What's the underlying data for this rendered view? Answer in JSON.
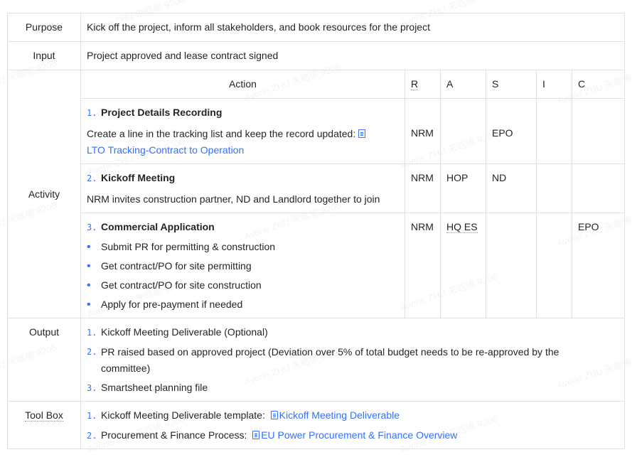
{
  "watermark": "Averie ZHU 朱皓瑜 9206",
  "rows": {
    "purpose": {
      "label": "Purpose",
      "text": "Kick off the project, inform all stakeholders, and book resources for the project"
    },
    "input": {
      "label": "Input",
      "text": "Project approved and lease contract signed"
    },
    "activity": {
      "label": "Activity",
      "headers": {
        "action": "Action",
        "r": "R",
        "a": "A",
        "s": "S",
        "i": "I",
        "c": "C"
      },
      "items": [
        {
          "num": "1.",
          "title": "Project Details Recording",
          "desc": "Create a line in the tracking list and keep the record updated:",
          "link": "LTO Tracking-Contract to Operation",
          "link_icon": "sheet-icon",
          "r": "NRM",
          "a": "",
          "s": "EPO",
          "i": "",
          "c": ""
        },
        {
          "num": "2.",
          "title": "Kickoff Meeting",
          "desc": "NRM invites construction partner, ND and Landlord together to join",
          "r": "NRM",
          "a": "HOP",
          "s": "ND",
          "i": "",
          "c": ""
        },
        {
          "num": "3.",
          "title": "Commercial Application",
          "bullets": [
            "Submit PR for permitting & construction",
            "Get contract/PO for site permitting",
            "Get contract/PO for site construction",
            "Apply for pre-payment if needed"
          ],
          "r": "NRM",
          "a": "HQ ES",
          "s": "",
          "i": "",
          "c": "EPO"
        }
      ]
    },
    "output": {
      "label": "Output",
      "items": [
        {
          "num": "1.",
          "text": "Kickoff Meeting Deliverable (Optional)"
        },
        {
          "num": "2.",
          "text": "PR raised based on approved project (Deviation over 5% of total budget needs to be re-approved by the committee)"
        },
        {
          "num": "3.",
          "text": "Smartsheet planning file"
        }
      ]
    },
    "toolbox": {
      "label": "Tool Box",
      "items": [
        {
          "num": "1.",
          "text": "Kickoff Meeting Deliverable template:",
          "link": "Kickoff Meeting Deliverable",
          "link_icon": "doc-icon"
        },
        {
          "num": "2.",
          "text": "Procurement & Finance Process:",
          "link": "EU Power Procurement & Finance Overview",
          "link_icon": "doc-icon"
        }
      ]
    }
  },
  "colors": {
    "link": "#3370ff",
    "border": "#dee0e3",
    "text": "#1f2329"
  }
}
